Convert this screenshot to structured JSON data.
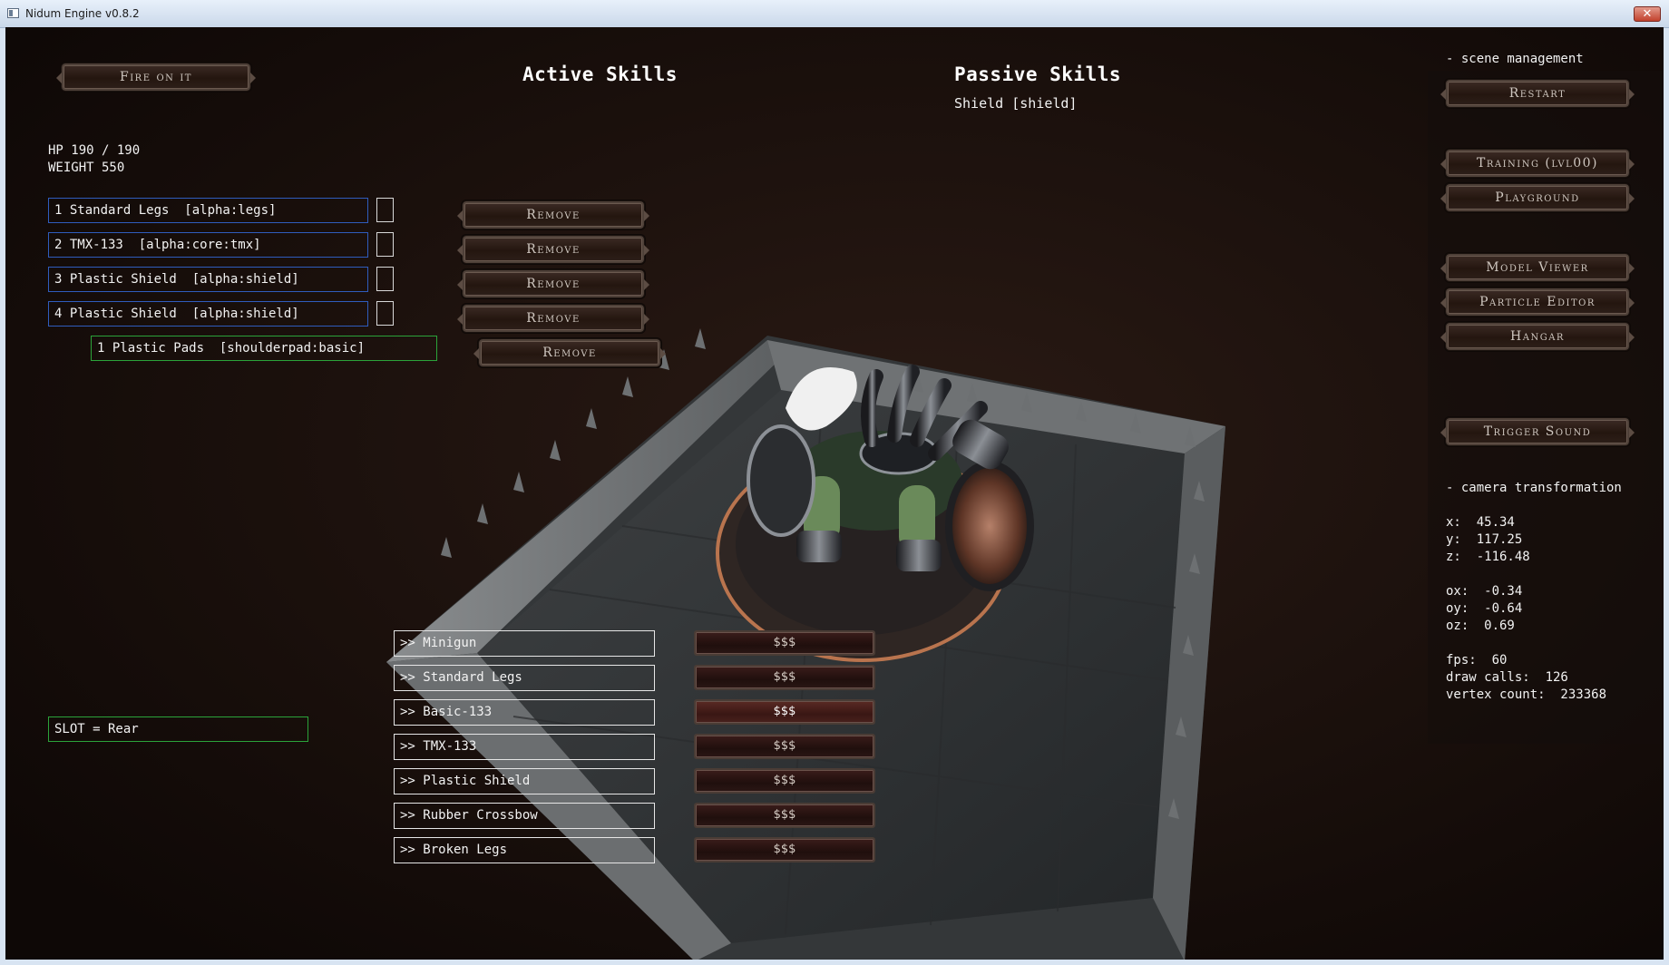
{
  "window": {
    "title": "Nidum Engine v0.8.2",
    "close_glyph": "✕"
  },
  "top": {
    "fire_button": "Fire on it",
    "active_skills": "Active Skills",
    "passive_skills": "Passive Skills",
    "passive_item": "Shield [shield]"
  },
  "stats": {
    "hp": "HP 190 / 190",
    "weight": "WEIGHT 550"
  },
  "slots": [
    {
      "label": "1 Standard Legs  [alpha:legs]",
      "remove": "Remove"
    },
    {
      "label": "2 TMX-133  [alpha:core:tmx]",
      "remove": "Remove"
    },
    {
      "label": "3 Plastic Shield  [alpha:shield]",
      "remove": "Remove"
    },
    {
      "label": "4 Plastic Shield  [alpha:shield]",
      "remove": "Remove"
    }
  ],
  "subslot": {
    "label": "1 Plastic Pads  [shoulderpad:basic]",
    "remove": "Remove"
  },
  "slot_indicator": "SLOT = Rear",
  "shop": [
    {
      "label": ">> Minigun",
      "price": "$$$"
    },
    {
      "label": ">> Standard Legs",
      "price": "$$$"
    },
    {
      "label": ">> Basic-133",
      "price": "$$$"
    },
    {
      "label": ">> TMX-133",
      "price": "$$$"
    },
    {
      "label": ">> Plastic Shield",
      "price": "$$$"
    },
    {
      "label": ">> Rubber Crossbow",
      "price": "$$$"
    },
    {
      "label": ">> Broken Legs",
      "price": "$$$"
    }
  ],
  "right": {
    "scene_header": "- scene management",
    "restart": "Restart",
    "training": "Training (lvl00)",
    "playground": "Playground",
    "model_viewer": "Model Viewer",
    "particle_editor": "Particle Editor",
    "hangar": "Hangar",
    "trigger_sound": "Trigger Sound",
    "camera_header": "- camera transformation",
    "cam_x": "x:  45.34",
    "cam_y": "y:  117.25",
    "cam_z": "z:  -116.48",
    "cam_ox": "ox:  -0.34",
    "cam_oy": "oy:  -0.64",
    "cam_oz": "oz:  0.69",
    "fps": "fps:  60",
    "draw_calls": "draw calls:  126",
    "vertex_count": "vertex count:  233368"
  }
}
